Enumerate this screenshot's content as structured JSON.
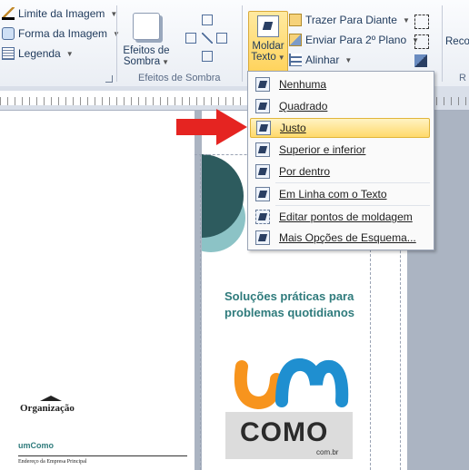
{
  "ribbon": {
    "arrange": {
      "limite": "Limite da Imagem",
      "forma": "Forma da Imagem",
      "legenda": "Legenda"
    },
    "efeitos_btn": [
      "Efeitos de",
      "Sombra"
    ],
    "efeitos_group": "Efeitos de Sombra",
    "moldar_btn": [
      "Moldar",
      "Texto"
    ],
    "trazer": "Trazer Para Diante",
    "enviar": "Enviar Para 2º Plano",
    "alinhar": "Alinhar",
    "partial_right": "Reco",
    "partial_group_right": "R"
  },
  "menu": {
    "items": [
      {
        "label": "Nenhuma",
        "icon": "wrap-none-icon"
      },
      {
        "label": "Quadrado",
        "icon": "wrap-square-icon"
      },
      {
        "label": "Justo",
        "icon": "wrap-tight-icon",
        "highlighted": true
      },
      {
        "label": "Superior e inferior",
        "icon": "wrap-top-bottom-icon"
      },
      {
        "label": "Por dentro",
        "icon": "wrap-through-icon"
      },
      {
        "label": "Em Linha com o Texto",
        "icon": "wrap-inline-icon"
      },
      {
        "label": "Editar pontos de moldagem",
        "icon": "edit-wrap-points-icon"
      },
      {
        "label": "Mais Opções de Esquema...",
        "icon": "layout-options-icon"
      }
    ]
  },
  "page_left": {
    "organizacao": "Organização",
    "umcomo": "umComo",
    "endereco": "Endereço da Empresa Principal"
  },
  "page_right": {
    "headline": "Soluções práticas para problemas quotidianos",
    "logo_text": "COMO",
    "logo_sub": "com.br"
  },
  "colors": {
    "accent_teal": "#2f7b7c",
    "dark_teal": "#2d5b5e",
    "light_teal": "#8cc3c6",
    "highlight": "#ffd96b",
    "arrow_red": "#e52421"
  }
}
